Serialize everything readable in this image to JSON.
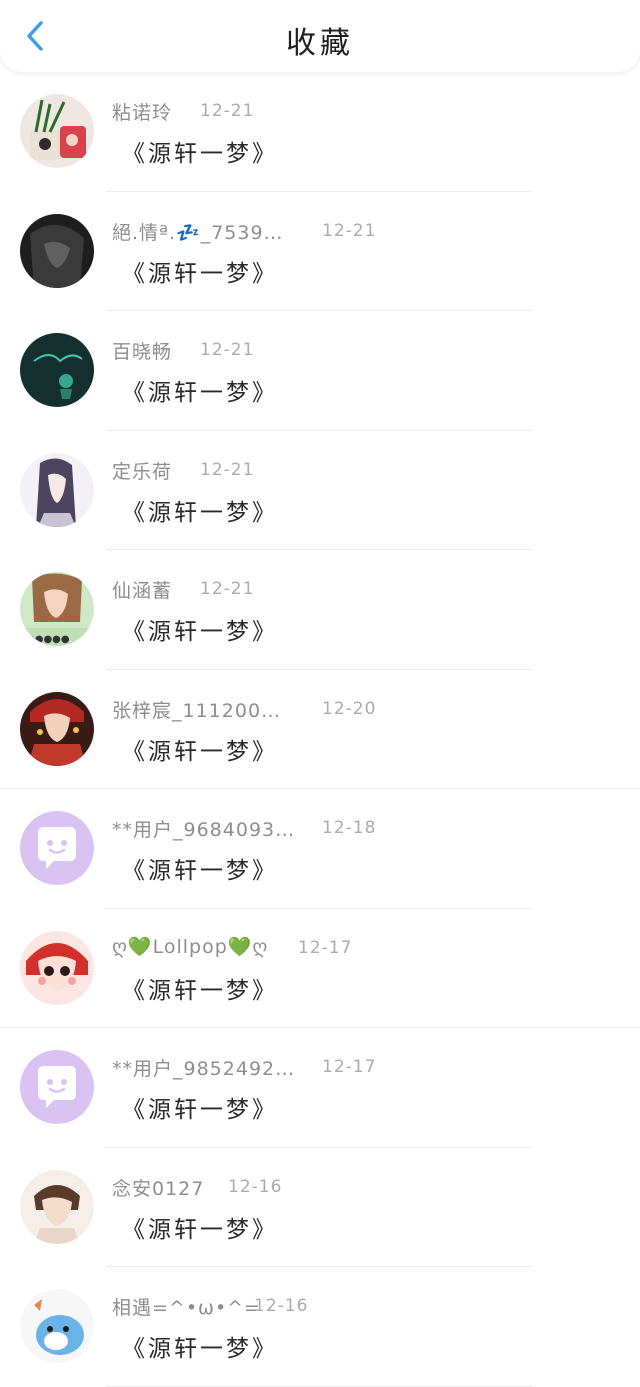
{
  "header": {
    "title": "收藏"
  },
  "items": [
    {
      "username": "粘诺玲",
      "date": "12-21",
      "content": "《源轩一梦》"
    },
    {
      "username": "絕.情ª.💤_7539…",
      "date": "12-21",
      "content": "《源轩一梦》"
    },
    {
      "username": "百晓畅",
      "date": "12-21",
      "content": "《源轩一梦》"
    },
    {
      "username": "定乐荷",
      "date": "12-21",
      "content": "《源轩一梦》"
    },
    {
      "username": "仙涵蓄",
      "date": "12-21",
      "content": "《源轩一梦》"
    },
    {
      "username": "张梓宸_111200…",
      "date": "12-20",
      "content": "《源轩一梦》"
    },
    {
      "username": "**用户_9684093…",
      "date": "12-18",
      "content": "《源轩一梦》"
    },
    {
      "username": "ღ💚Lollpop💚ღ",
      "date": "12-17",
      "content": "《源轩一梦》"
    },
    {
      "username": "**用户_9852492…",
      "date": "12-17",
      "content": "《源轩一梦》"
    },
    {
      "username": "念安0127",
      "date": "12-16",
      "content": "《源轩一梦》"
    },
    {
      "username": "相遇=^•ω•^=",
      "date": "12-16",
      "content": "《源轩一梦》"
    }
  ],
  "colors": {
    "accent": "#3aa0e8",
    "default_avatar": "#d8c3f3"
  }
}
